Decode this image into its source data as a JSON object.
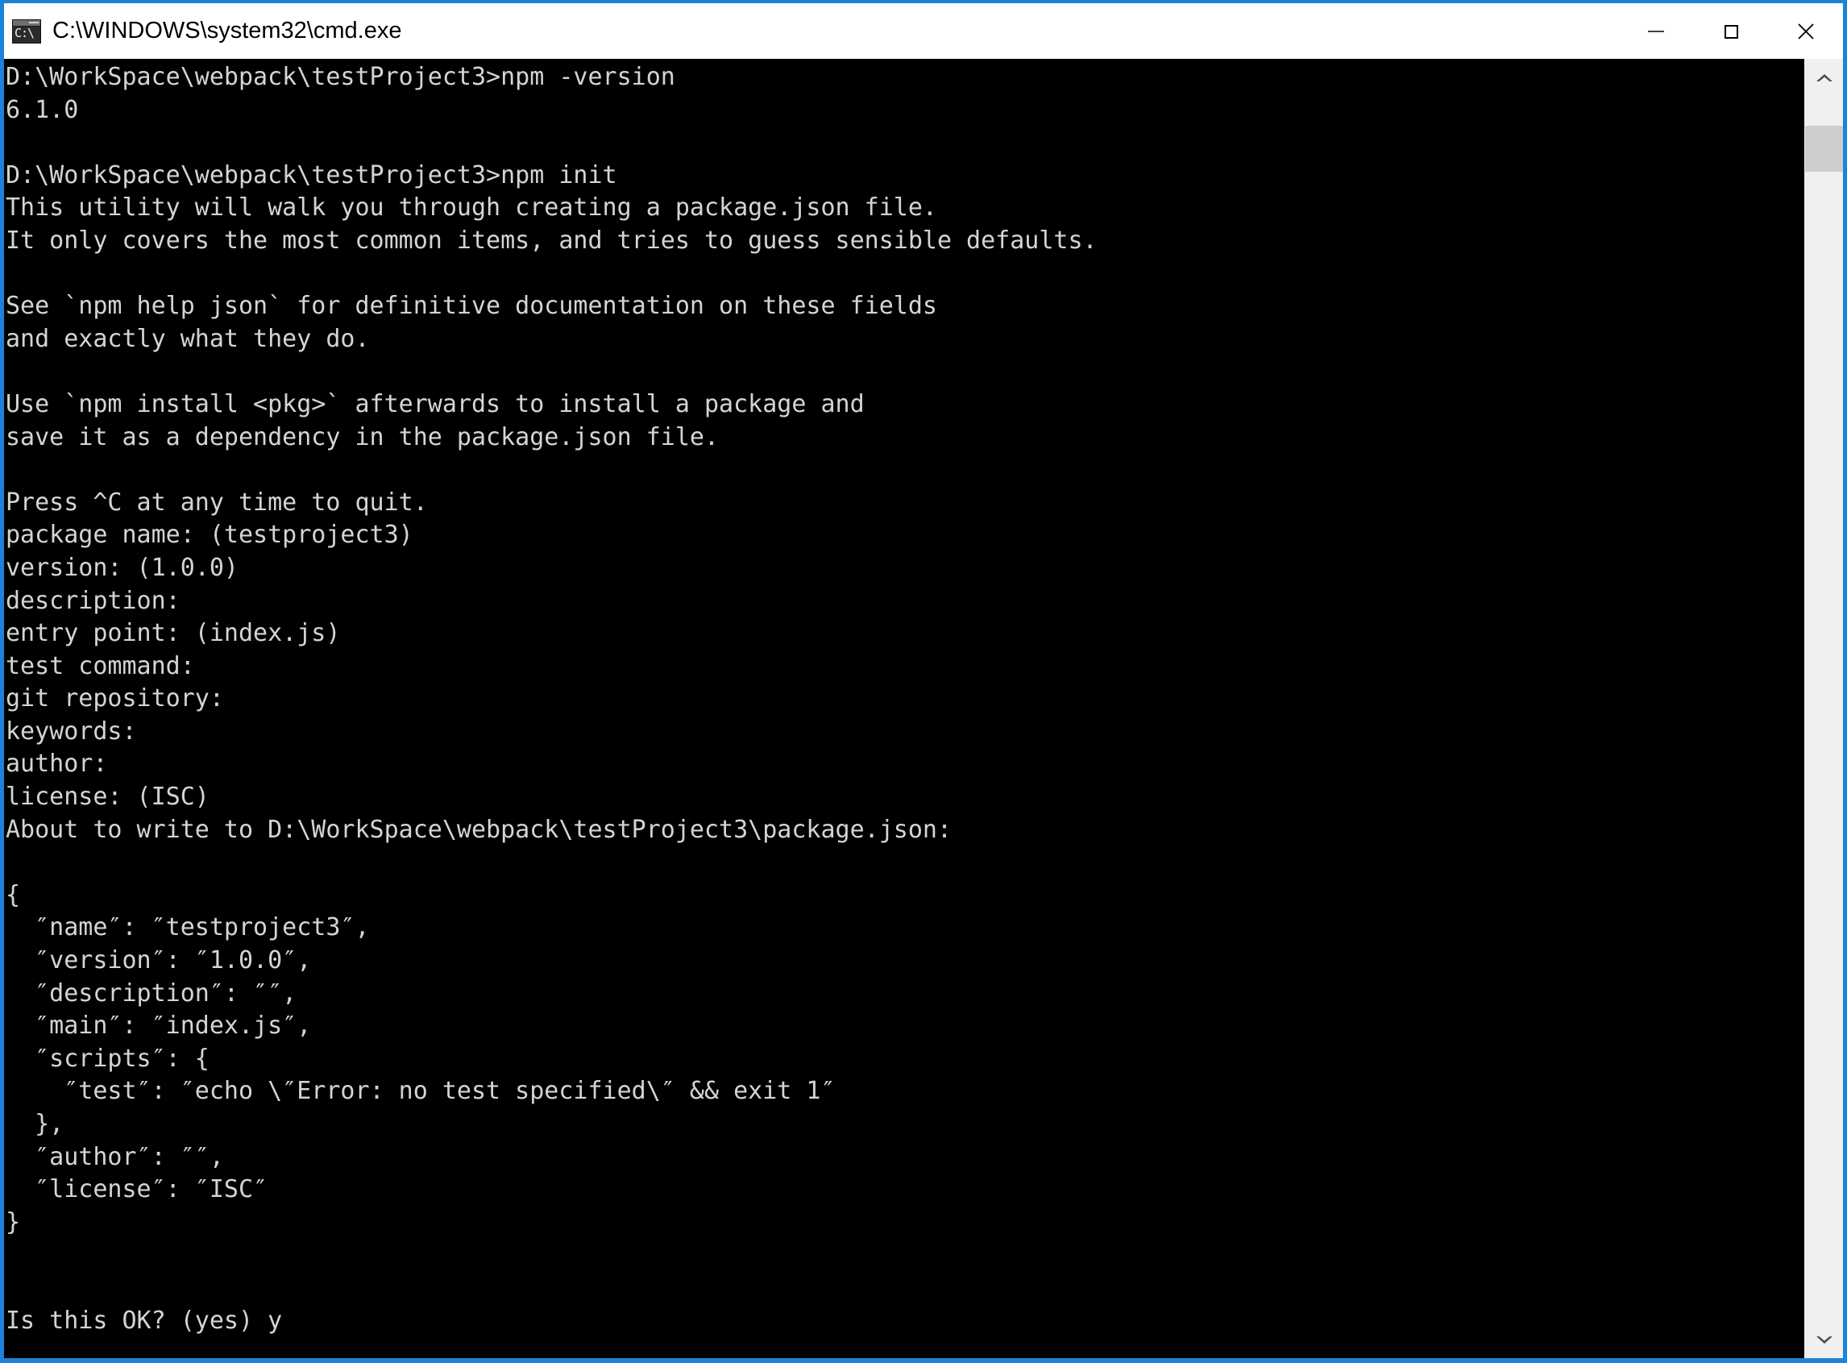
{
  "window": {
    "title": "C:\\WINDOWS\\system32\\cmd.exe",
    "icon": "cmd-icon",
    "icon_glyph": "C:\\",
    "accent_color": "#1b84d8",
    "titlebar_bg": "#ffffff",
    "console_bg": "#000000",
    "console_fg": "#d4d4d4",
    "controls": {
      "minimize_label": "Minimize",
      "maximize_label": "Maximize",
      "close_label": "Close"
    }
  },
  "scrollbar": {
    "up_label": "Scroll up",
    "down_label": "Scroll down",
    "thumb_label": "Scroll thumb",
    "track_color": "#f0f0f0",
    "thumb_color": "#cdcdcd"
  },
  "console": {
    "lines": [
      "D:\\WorkSpace\\webpack\\testProject3>npm -version",
      "6.1.0",
      "",
      "D:\\WorkSpace\\webpack\\testProject3>npm init",
      "This utility will walk you through creating a package.json file.",
      "It only covers the most common items, and tries to guess sensible defaults.",
      "",
      "See `npm help json` for definitive documentation on these fields",
      "and exactly what they do.",
      "",
      "Use `npm install <pkg>` afterwards to install a package and",
      "save it as a dependency in the package.json file.",
      "",
      "Press ^C at any time to quit.",
      "package name: (testproject3)",
      "version: (1.0.0)",
      "description:",
      "entry point: (index.js)",
      "test command:",
      "git repository:",
      "keywords:",
      "author:",
      "license: (ISC)",
      "About to write to D:\\WorkSpace\\webpack\\testProject3\\package.json:",
      "",
      "{",
      "  ″name″: ″testproject3″,",
      "  ″version″: ″1.0.0″,",
      "  ″description″: ″″,",
      "  ″main″: ″index.js″,",
      "  ″scripts″: {",
      "    ″test″: ″echo \\″Error: no test specified\\″ && exit 1″",
      "  },",
      "  ″author″: ″″,",
      "  ″license″: ″ISC″",
      "}",
      "",
      "",
      "Is this OK? (yes) y"
    ]
  }
}
